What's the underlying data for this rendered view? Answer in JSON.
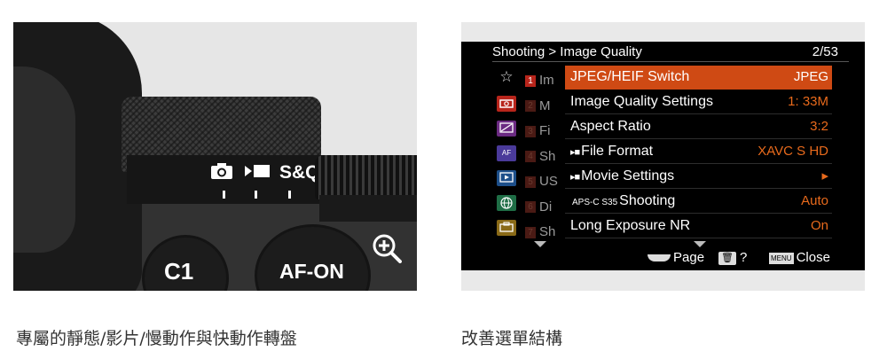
{
  "left_photo": {
    "dial_modes": [
      "S&Q"
    ],
    "buttons": {
      "c1": "C1",
      "af_on": "AF-ON"
    },
    "zoom_icon": "magnify-plus-icon"
  },
  "menu_screen": {
    "breadcrumb": "Shooting > Image Quality",
    "page_indicator": "2/53",
    "tabs": [
      {
        "icon": "star-icon",
        "color": "#000000"
      },
      {
        "icon": "camera-icon",
        "color": "#b8251b"
      },
      {
        "icon": "exposure-icon",
        "color": "#6b2a82"
      },
      {
        "icon": "af-icon",
        "color": "#4a3a9a"
      },
      {
        "icon": "playback-icon",
        "color": "#1d4f8a"
      },
      {
        "icon": "network-icon",
        "color": "#1f6e46"
      },
      {
        "icon": "toolbox-icon",
        "color": "#8a6a17"
      }
    ],
    "ghost_items": [
      {
        "num": "1",
        "text": "Im"
      },
      {
        "num": "2",
        "text": "M"
      },
      {
        "num": "3",
        "text": "Fi"
      },
      {
        "num": "4",
        "text": "Sh"
      },
      {
        "num": "5",
        "text": "US"
      },
      {
        "num": "6",
        "text": "Di"
      },
      {
        "num": "7",
        "text": "Sh"
      }
    ],
    "items": [
      {
        "label": "JPEG/HEIF Switch",
        "value": "JPEG",
        "selected": true
      },
      {
        "label": "Image Quality Settings",
        "value": "1: 33M"
      },
      {
        "label": "Aspect Ratio",
        "value": "3:2"
      },
      {
        "prefix": "▸■",
        "label": "File Format",
        "value": "XAVC S HD"
      },
      {
        "prefix": "▸■",
        "label": "Movie Settings",
        "value": "▸"
      },
      {
        "prefix": "APS-C S35",
        "label": "Shooting",
        "value": "Auto"
      },
      {
        "label": "Long Exposure NR",
        "value": "On"
      }
    ],
    "footer": {
      "page_label": "Page",
      "help_label": "?",
      "menu_key_text": "MENU",
      "close_label": "Close"
    }
  },
  "captions": {
    "left": "專屬的靜態/影片/慢動作與快動作轉盤",
    "right": "改善選單結構"
  },
  "colors": {
    "accent_orange": "#cf4a14",
    "value_orange": "#e86a1c"
  }
}
